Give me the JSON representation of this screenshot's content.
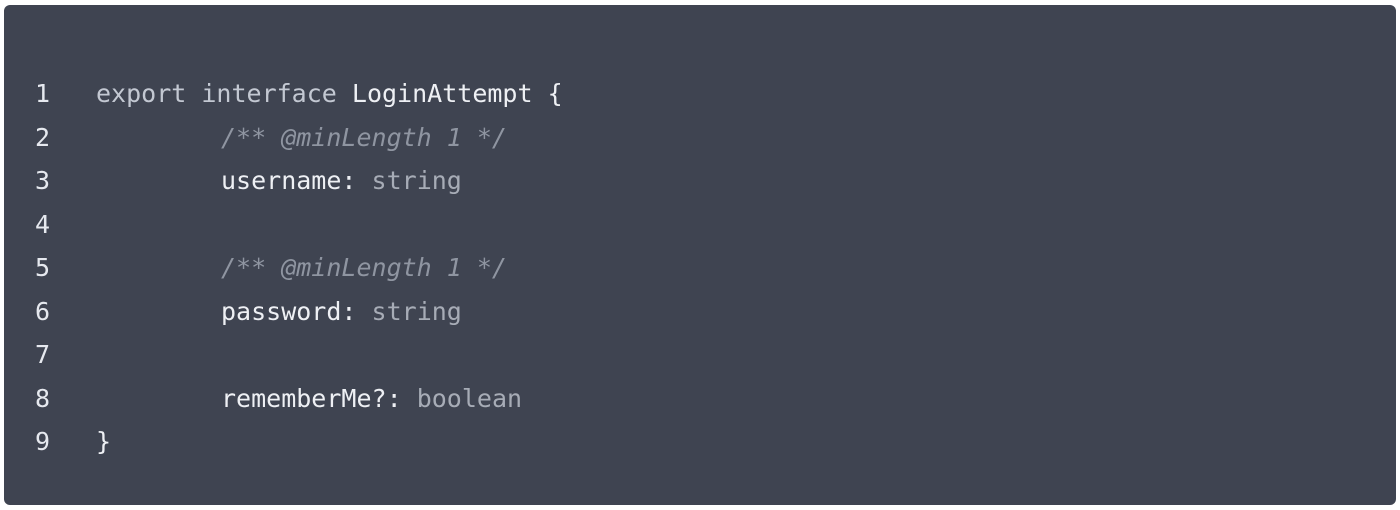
{
  "code_block": {
    "lines": [
      {
        "number": "1",
        "tokens": {
          "kw1": "export",
          "kw2": "interface",
          "name": "LoginAttempt",
          "brace": "{"
        }
      },
      {
        "number": "2",
        "comment": "/** @minLength 1 */"
      },
      {
        "number": "3",
        "prop": "username",
        "colon": ":",
        "type": "string"
      },
      {
        "number": "4"
      },
      {
        "number": "5",
        "comment": "/** @minLength 1 */"
      },
      {
        "number": "6",
        "prop": "password",
        "colon": ":",
        "type": "string"
      },
      {
        "number": "7"
      },
      {
        "number": "8",
        "prop": "rememberMe?",
        "colon": ":",
        "type": "boolean"
      },
      {
        "number": "9",
        "brace": "}"
      }
    ]
  },
  "colors": {
    "panel_background": "#3f4451",
    "text": "#e6e9ef",
    "comment": "#8f95a1",
    "type": "#a7acb6"
  }
}
